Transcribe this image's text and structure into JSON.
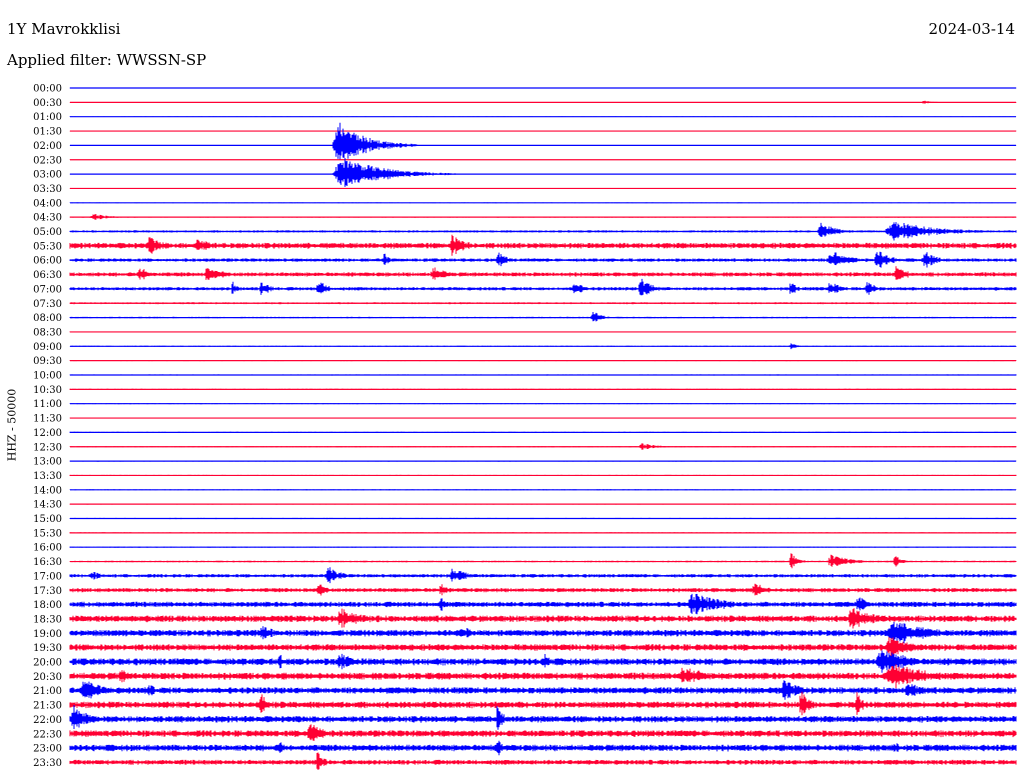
{
  "header": {
    "station": "1Y Mavrokklisi",
    "date": "2024-03-14",
    "filter": "Applied filter: WWSSN-SP"
  },
  "channel_label": "HHZ - 50000",
  "colors": {
    "blue": "#0000ff",
    "red": "#ff0033"
  },
  "chart_data": {
    "type": "line",
    "title": "1Y Mavrokklisi",
    "subtitle": "Applied filter: WWSSN-SP",
    "ylabel": "HHZ - 50000",
    "grid": false,
    "rows": [
      "00:00",
      "00:30",
      "01:00",
      "01:30",
      "02:00",
      "02:30",
      "03:00",
      "03:30",
      "04:00",
      "04:30",
      "05:00",
      "05:30",
      "06:00",
      "06:30",
      "07:00",
      "07:30",
      "08:00",
      "08:30",
      "09:00",
      "09:30",
      "10:00",
      "10:30",
      "11:00",
      "11:30",
      "12:00",
      "12:30",
      "13:00",
      "13:30",
      "14:00",
      "14:30",
      "15:00",
      "15:30",
      "16:00",
      "16:30",
      "17:00",
      "17:30",
      "18:00",
      "18:30",
      "19:00",
      "19:30",
      "20:00",
      "20:30",
      "21:00",
      "21:30",
      "22:00",
      "22:30",
      "23:00",
      "23:30"
    ],
    "row_colors": [
      "blue",
      "red"
    ],
    "row_minutes": 30,
    "noise": [
      0.3,
      0.3,
      0.3,
      0.3,
      0.3,
      0.3,
      0.4,
      0.4,
      0.4,
      0.6,
      1.2,
      3.0,
      1.8,
      2.2,
      1.8,
      1.0,
      0.8,
      0.5,
      0.6,
      0.5,
      0.6,
      0.6,
      0.5,
      0.5,
      0.6,
      0.6,
      0.6,
      0.6,
      0.5,
      0.5,
      0.6,
      0.6,
      0.6,
      0.9,
      1.8,
      2.2,
      2.8,
      3.4,
      3.4,
      3.4,
      3.6,
      3.6,
      3.4,
      3.4,
      3.4,
      3.4,
      3.4,
      2.6
    ],
    "events": [
      {
        "row": 4,
        "t": 0.277,
        "dur": 0.09,
        "amp": 24
      },
      {
        "row": 6,
        "t": 0.277,
        "dur": 0.13,
        "amp": 18
      },
      {
        "row": 9,
        "t": 0.02,
        "dur": 0.05,
        "amp": 4
      },
      {
        "row": 1,
        "t": 0.9,
        "dur": 0.03,
        "amp": 2
      },
      {
        "row": 10,
        "t": 0.79,
        "dur": 0.05,
        "amp": 10
      },
      {
        "row": 10,
        "t": 0.86,
        "dur": 0.14,
        "amp": 11
      },
      {
        "row": 11,
        "t": 0.08,
        "dur": 0.05,
        "amp": 10
      },
      {
        "row": 11,
        "t": 0.13,
        "dur": 0.06,
        "amp": 8
      },
      {
        "row": 11,
        "t": 0.4,
        "dur": 0.05,
        "amp": 12
      },
      {
        "row": 12,
        "t": 0.33,
        "dur": 0.02,
        "amp": 8
      },
      {
        "row": 12,
        "t": 0.45,
        "dur": 0.03,
        "amp": 9
      },
      {
        "row": 12,
        "t": 0.8,
        "dur": 0.06,
        "amp": 10
      },
      {
        "row": 12,
        "t": 0.85,
        "dur": 0.04,
        "amp": 12
      },
      {
        "row": 12,
        "t": 0.9,
        "dur": 0.04,
        "amp": 10
      },
      {
        "row": 13,
        "t": 0.07,
        "dur": 0.04,
        "amp": 9
      },
      {
        "row": 13,
        "t": 0.14,
        "dur": 0.06,
        "amp": 8
      },
      {
        "row": 13,
        "t": 0.38,
        "dur": 0.05,
        "amp": 8
      },
      {
        "row": 13,
        "t": 0.87,
        "dur": 0.04,
        "amp": 9
      },
      {
        "row": 14,
        "t": 0.17,
        "dur": 0.02,
        "amp": 8
      },
      {
        "row": 14,
        "t": 0.2,
        "dur": 0.03,
        "amp": 9
      },
      {
        "row": 14,
        "t": 0.26,
        "dur": 0.03,
        "amp": 10
      },
      {
        "row": 14,
        "t": 0.53,
        "dur": 0.03,
        "amp": 9
      },
      {
        "row": 14,
        "t": 0.6,
        "dur": 0.04,
        "amp": 12
      },
      {
        "row": 14,
        "t": 0.76,
        "dur": 0.02,
        "amp": 9
      },
      {
        "row": 14,
        "t": 0.8,
        "dur": 0.04,
        "amp": 8
      },
      {
        "row": 14,
        "t": 0.84,
        "dur": 0.03,
        "amp": 9
      },
      {
        "row": 16,
        "t": 0.55,
        "dur": 0.03,
        "amp": 7
      },
      {
        "row": 18,
        "t": 0.76,
        "dur": 0.02,
        "amp": 4
      },
      {
        "row": 25,
        "t": 0.6,
        "dur": 0.05,
        "amp": 4
      },
      {
        "row": 33,
        "t": 0.76,
        "dur": 0.02,
        "amp": 12
      },
      {
        "row": 33,
        "t": 0.8,
        "dur": 0.06,
        "amp": 8
      },
      {
        "row": 33,
        "t": 0.87,
        "dur": 0.02,
        "amp": 9
      },
      {
        "row": 34,
        "t": 0.02,
        "dur": 0.04,
        "amp": 5
      },
      {
        "row": 34,
        "t": 0.27,
        "dur": 0.04,
        "amp": 10
      },
      {
        "row": 34,
        "t": 0.4,
        "dur": 0.05,
        "amp": 9
      },
      {
        "row": 35,
        "t": 0.26,
        "dur": 0.03,
        "amp": 8
      },
      {
        "row": 35,
        "t": 0.39,
        "dur": 0.02,
        "amp": 8
      },
      {
        "row": 35,
        "t": 0.72,
        "dur": 0.04,
        "amp": 9
      },
      {
        "row": 36,
        "t": 0.39,
        "dur": 0.02,
        "amp": 9
      },
      {
        "row": 36,
        "t": 0.65,
        "dur": 0.1,
        "amp": 13
      },
      {
        "row": 36,
        "t": 0.83,
        "dur": 0.04,
        "amp": 9
      },
      {
        "row": 37,
        "t": 0.28,
        "dur": 0.08,
        "amp": 11
      },
      {
        "row": 37,
        "t": 0.82,
        "dur": 0.08,
        "amp": 12
      },
      {
        "row": 38,
        "t": 0.2,
        "dur": 0.04,
        "amp": 10
      },
      {
        "row": 38,
        "t": 0.41,
        "dur": 0.04,
        "amp": 9
      },
      {
        "row": 38,
        "t": 0.86,
        "dur": 0.12,
        "amp": 14
      },
      {
        "row": 39,
        "t": 0.86,
        "dur": 0.08,
        "amp": 12
      },
      {
        "row": 40,
        "t": 0.22,
        "dur": 0.02,
        "amp": 9
      },
      {
        "row": 40,
        "t": 0.28,
        "dur": 0.06,
        "amp": 10
      },
      {
        "row": 40,
        "t": 0.5,
        "dur": 0.02,
        "amp": 11
      },
      {
        "row": 40,
        "t": 0.85,
        "dur": 0.1,
        "amp": 14
      },
      {
        "row": 41,
        "t": 0.05,
        "dur": 0.04,
        "amp": 8
      },
      {
        "row": 41,
        "t": 0.64,
        "dur": 0.1,
        "amp": 10
      },
      {
        "row": 41,
        "t": 0.86,
        "dur": 0.13,
        "amp": 14
      },
      {
        "row": 42,
        "t": 0.01,
        "dur": 0.06,
        "amp": 13
      },
      {
        "row": 42,
        "t": 0.08,
        "dur": 0.03,
        "amp": 8
      },
      {
        "row": 42,
        "t": 0.75,
        "dur": 0.06,
        "amp": 11
      },
      {
        "row": 42,
        "t": 0.88,
        "dur": 0.06,
        "amp": 10
      },
      {
        "row": 43,
        "t": 0.2,
        "dur": 0.02,
        "amp": 14
      },
      {
        "row": 43,
        "t": 0.77,
        "dur": 0.03,
        "amp": 16
      },
      {
        "row": 43,
        "t": 0.83,
        "dur": 0.02,
        "amp": 14
      },
      {
        "row": 44,
        "t": 0.0,
        "dur": 0.05,
        "amp": 15
      },
      {
        "row": 44,
        "t": 0.45,
        "dur": 0.02,
        "amp": 16
      },
      {
        "row": 45,
        "t": 0.25,
        "dur": 0.04,
        "amp": 16
      },
      {
        "row": 46,
        "t": 0.22,
        "dur": 0.02,
        "amp": 9
      },
      {
        "row": 46,
        "t": 0.45,
        "dur": 0.02,
        "amp": 10
      },
      {
        "row": 46,
        "t": 0.87,
        "dur": 0.02,
        "amp": 8
      },
      {
        "row": 47,
        "t": 0.26,
        "dur": 0.02,
        "amp": 14
      }
    ]
  }
}
